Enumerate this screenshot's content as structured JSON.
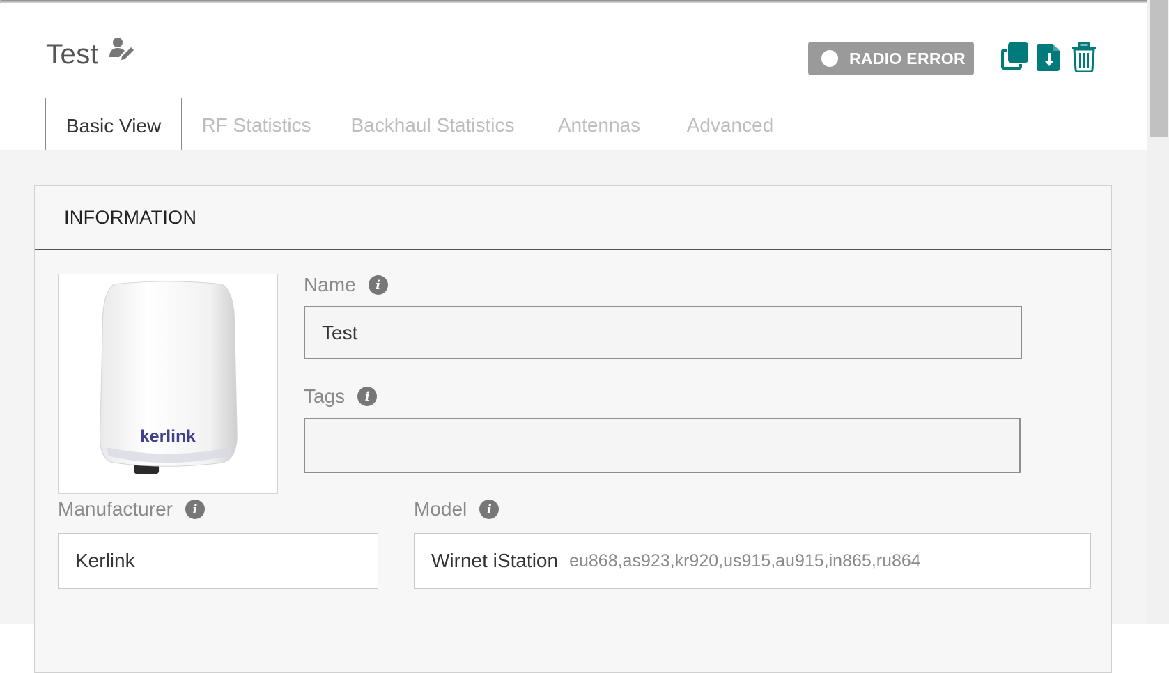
{
  "header": {
    "title": "Test",
    "status": "RADIO ERROR",
    "icons": [
      "user-edit-icon",
      "clone-icon",
      "download-icon",
      "trash-icon"
    ],
    "accent_color": "#007a7a",
    "status_color": "#9a9a9a"
  },
  "tabs": [
    {
      "label": "Basic View",
      "active": true
    },
    {
      "label": "RF Statistics",
      "active": false
    },
    {
      "label": "Backhaul Statistics",
      "active": false
    },
    {
      "label": "Antennas",
      "active": false
    },
    {
      "label": "Advanced",
      "active": false
    }
  ],
  "panel": {
    "title": "INFORMATION",
    "device_brand": "kerlink",
    "fields": {
      "name": {
        "label": "Name",
        "value": "Test"
      },
      "tags": {
        "label": "Tags",
        "value": ""
      },
      "manufacturer": {
        "label": "Manufacturer",
        "value": "Kerlink"
      },
      "model": {
        "label": "Model",
        "value": "Wirnet iStation",
        "bands": "eu868,as923,kr920,us915,au915,in865,ru864"
      }
    }
  }
}
